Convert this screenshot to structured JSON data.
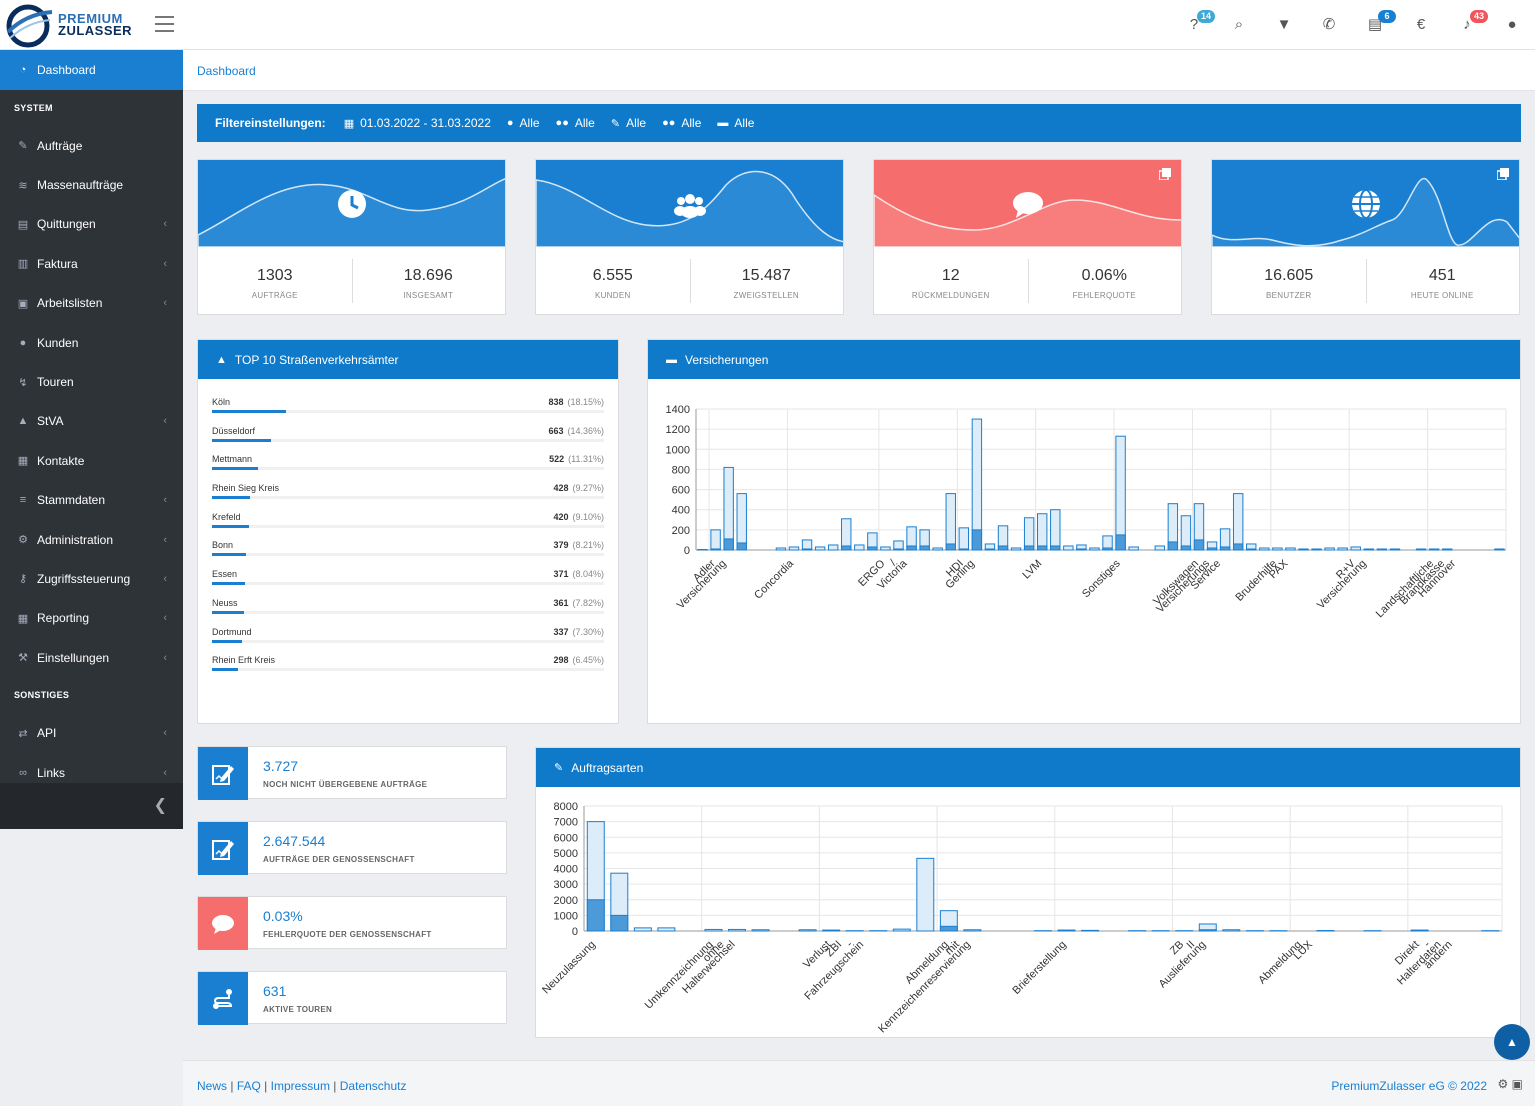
{
  "header": {
    "logo_line1": "PREMIUM",
    "logo_line2": "ZULASSER",
    "icons": [
      {
        "name": "help-icon",
        "glyph": "?",
        "badge": "14",
        "badge_color": "#3fa9d6"
      },
      {
        "name": "search-icon",
        "glyph": "⌕",
        "badge": "",
        "badge_color": ""
      },
      {
        "name": "filter-icon",
        "glyph": "▼",
        "badge": "",
        "badge_color": ""
      },
      {
        "name": "phone-icon",
        "glyph": "✆",
        "badge": "",
        "badge_color": ""
      },
      {
        "name": "documents-icon",
        "glyph": "▤",
        "badge": "6",
        "badge_color": "#1a7fd0"
      },
      {
        "name": "euro-icon",
        "glyph": "€",
        "badge": "",
        "badge_color": ""
      },
      {
        "name": "bell-icon",
        "glyph": "♪",
        "badge": "43",
        "badge_color": "#f2545b"
      },
      {
        "name": "user-icon",
        "glyph": "●",
        "badge": "",
        "badge_color": ""
      }
    ]
  },
  "sidebar": {
    "active": {
      "label": "Dashboard",
      "icon": "dashboard-icon"
    },
    "section_system": "SYSTEM",
    "section_other": "SONSTIGES",
    "items": [
      {
        "label": "Aufträge",
        "icon": "edit-icon",
        "chevron": false
      },
      {
        "label": "Massenaufträge",
        "icon": "layers-icon",
        "chevron": false
      },
      {
        "label": "Quittungen",
        "icon": "receipt-icon",
        "chevron": true
      },
      {
        "label": "Faktura",
        "icon": "invoice-icon",
        "chevron": true
      },
      {
        "label": "Arbeitslisten",
        "icon": "clipboard-icon",
        "chevron": true
      },
      {
        "label": "Kunden",
        "icon": "users-icon",
        "chevron": false
      },
      {
        "label": "Touren",
        "icon": "route-icon",
        "chevron": false
      },
      {
        "label": "StVA",
        "icon": "road-icon",
        "chevron": true
      },
      {
        "label": "Kontakte",
        "icon": "contacts-icon",
        "chevron": false
      },
      {
        "label": "Stammdaten",
        "icon": "list-icon",
        "chevron": true
      },
      {
        "label": "Administration",
        "icon": "cogs-icon",
        "chevron": true
      },
      {
        "label": "Zugriffssteuerung",
        "icon": "key-icon",
        "chevron": true
      },
      {
        "label": "Reporting",
        "icon": "table-icon",
        "chevron": true
      },
      {
        "label": "Einstellungen",
        "icon": "wrench-icon",
        "chevron": true
      }
    ],
    "other_items": [
      {
        "label": "API",
        "icon": "exchange-icon",
        "chevron": true
      },
      {
        "label": "Links",
        "icon": "link-icon",
        "chevron": true
      }
    ]
  },
  "breadcrumb": "Dashboard",
  "filter": {
    "title": "Filtereinstellungen:",
    "items": [
      {
        "icon": "calendar-icon",
        "glyph": "▦",
        "label": "01.03.2022 - 31.03.2022"
      },
      {
        "icon": "user-icon",
        "glyph": "●",
        "label": "Alle"
      },
      {
        "icon": "users-icon",
        "glyph": "●●",
        "label": "Alle"
      },
      {
        "icon": "edit-icon",
        "glyph": "✎",
        "label": "Alle"
      },
      {
        "icon": "group-icon",
        "glyph": "●●",
        "label": "Alle"
      },
      {
        "icon": "car-icon",
        "glyph": "▬",
        "label": "Alle"
      }
    ]
  },
  "cards": [
    {
      "color": "#1a7fd0",
      "icon": "clock-icon",
      "copy": false,
      "stats": [
        {
          "value": "1303",
          "label": "AUFTRÄGE"
        },
        {
          "value": "18.696",
          "label": "INSGESAMT"
        }
      ]
    },
    {
      "color": "#1a7fd0",
      "icon": "users-icon",
      "copy": false,
      "stats": [
        {
          "value": "6.555",
          "label": "KUNDEN"
        },
        {
          "value": "15.487",
          "label": "ZWEIGSTELLEN"
        }
      ]
    },
    {
      "color": "#f66d6d",
      "icon": "comment-icon",
      "copy": true,
      "stats": [
        {
          "value": "12",
          "label": "RÜCKMELDUNGEN"
        },
        {
          "value": "0.06%",
          "label": "FEHLERQUOTE"
        }
      ]
    },
    {
      "color": "#1a7fd0",
      "icon": "globe-icon",
      "copy": true,
      "stats": [
        {
          "value": "16.605",
          "label": "BENUTZER"
        },
        {
          "value": "451",
          "label": "HEUTE ONLINE"
        }
      ]
    }
  ],
  "top10": {
    "title": "TOP 10 Straßenverkehrsämter",
    "rows": [
      {
        "name": "Köln",
        "value": "838",
        "pct": "(18.15%)",
        "fraction": 0.1815
      },
      {
        "name": "Düsseldorf",
        "value": "663",
        "pct": "(14.36%)",
        "fraction": 0.1436
      },
      {
        "name": "Mettmann",
        "value": "522",
        "pct": "(11.31%)",
        "fraction": 0.1131
      },
      {
        "name": "Rhein Sieg Kreis",
        "value": "428",
        "pct": "(9.27%)",
        "fraction": 0.0927
      },
      {
        "name": "Krefeld",
        "value": "420",
        "pct": "(9.10%)",
        "fraction": 0.091
      },
      {
        "name": "Bonn",
        "value": "379",
        "pct": "(8.21%)",
        "fraction": 0.0821
      },
      {
        "name": "Essen",
        "value": "371",
        "pct": "(8.04%)",
        "fraction": 0.0804
      },
      {
        "name": "Neuss",
        "value": "361",
        "pct": "(7.82%)",
        "fraction": 0.0782
      },
      {
        "name": "Dortmund",
        "value": "337",
        "pct": "(7.30%)",
        "fraction": 0.073
      },
      {
        "name": "Rhein Erft Kreis",
        "value": "298",
        "pct": "(6.45%)",
        "fraction": 0.0645
      }
    ]
  },
  "versicherungen_title": "Versicherungen",
  "auftragsarten_title": "Auftragsarten",
  "info_cards": [
    {
      "value": "3.727",
      "label": "NOCH NICHT ÜBERGEBENE AUFTRÄGE",
      "icon": "edit-icon",
      "color": "#1a7fd0"
    },
    {
      "value": "2.647.544",
      "label": "AUFTRÄGE DER GENOSSENSCHAFT",
      "icon": "edit-icon",
      "color": "#1a7fd0"
    },
    {
      "value": "0.03%",
      "label": "FEHLERQUOTE DER GENOSSENSCHAFT",
      "icon": "comment-icon",
      "color": "#f66d6d"
    },
    {
      "value": "631",
      "label": "AKTIVE TOUREN",
      "icon": "route-icon",
      "color": "#1a7fd0"
    }
  ],
  "footer": {
    "links": [
      "News",
      "FAQ",
      "Impressum",
      "Datenschutz"
    ],
    "copyright": "PremiumZulasser eG © 2022"
  },
  "chart_data": [
    {
      "type": "bar",
      "title": "",
      "ylim": [
        0,
        1400
      ],
      "yticks": [
        0,
        200,
        400,
        600,
        800,
        1000,
        1200,
        1400
      ],
      "x_tick_labels": [
        {
          "index": 1,
          "lines": [
            "Adler",
            "Versicherung"
          ]
        },
        {
          "index": 7,
          "lines": [
            "Concordia"
          ]
        },
        {
          "index": 14,
          "lines": [
            "ERGO",
            "/",
            "Victoria"
          ]
        },
        {
          "index": 20,
          "lines": [
            "HDI",
            "Gerling"
          ]
        },
        {
          "index": 26,
          "lines": [
            "LVM"
          ]
        },
        {
          "index": 32,
          "lines": [
            "Sonstiges"
          ]
        },
        {
          "index": 38,
          "lines": [
            "Volkswagen",
            "Versicherungs",
            "Service"
          ]
        },
        {
          "index": 44,
          "lines": [
            "Bruderhilfe",
            "PAX"
          ]
        },
        {
          "index": 50,
          "lines": [
            "R+V",
            "Versicherung"
          ]
        },
        {
          "index": 56,
          "lines": [
            "Landschaftliche",
            "Brandkasse",
            "Hannover"
          ]
        }
      ],
      "grid": true,
      "series": [
        {
          "values": [
            5,
            200,
            820,
            560,
            0,
            0,
            20,
            30,
            100,
            30,
            50,
            310,
            50,
            170,
            30,
            90,
            230,
            200,
            20,
            560,
            220,
            1300,
            60,
            240,
            20,
            320,
            360,
            400,
            40,
            50,
            20,
            140,
            1130,
            30,
            0,
            40,
            460,
            340,
            460,
            80,
            210,
            560,
            60,
            20,
            20,
            20,
            10,
            10,
            20,
            20,
            30,
            10,
            10,
            10,
            0,
            10,
            10,
            10,
            0,
            0,
            0,
            10
          ]
        },
        {
          "values": [
            0,
            10,
            110,
            70,
            0,
            0,
            0,
            0,
            10,
            0,
            0,
            40,
            0,
            30,
            0,
            10,
            40,
            40,
            0,
            60,
            10,
            200,
            10,
            40,
            0,
            40,
            40,
            40,
            0,
            10,
            0,
            20,
            150,
            0,
            0,
            0,
            80,
            40,
            100,
            20,
            30,
            60,
            10,
            0,
            0,
            0,
            0,
            0,
            0,
            0,
            0,
            0,
            0,
            0,
            0,
            0,
            0,
            0,
            0,
            0,
            0,
            0
          ]
        }
      ]
    },
    {
      "type": "bar",
      "title": "",
      "ylim": [
        0,
        8000
      ],
      "yticks": [
        0,
        1000,
        2000,
        3000,
        4000,
        5000,
        6000,
        7000,
        8000
      ],
      "x_tick_labels": [
        {
          "index": 0,
          "lines": [
            "Neuzulassung"
          ]
        },
        {
          "index": 5,
          "lines": [
            "Umkennzeichnung",
            "ohne",
            "Halterwechsel"
          ]
        },
        {
          "index": 10,
          "lines": [
            "Verlust",
            "ZBI",
            "-",
            "Fahrzeugschein"
          ]
        },
        {
          "index": 15,
          "lines": [
            "Abmeldung",
            "mit",
            "Kennzeichenreservierung"
          ]
        },
        {
          "index": 20,
          "lines": [
            "Brieferstellung"
          ]
        },
        {
          "index": 25,
          "lines": [
            "ZB",
            "II",
            "Auslieferung"
          ]
        },
        {
          "index": 30,
          "lines": [
            "Abmeldung",
            "LUX"
          ]
        },
        {
          "index": 35,
          "lines": [
            "Direkt",
            "-",
            "Halterdaten",
            "ändern"
          ]
        }
      ],
      "grid": true,
      "series": [
        {
          "values": [
            7000,
            3700,
            200,
            200,
            0,
            100,
            100,
            80,
            0,
            80,
            60,
            20,
            20,
            120,
            4650,
            1300,
            80,
            0,
            0,
            20,
            60,
            40,
            0,
            20,
            20,
            20,
            450,
            80,
            20,
            20,
            0,
            30,
            0,
            20,
            0,
            60,
            0,
            0,
            20
          ]
        },
        {
          "values": [
            2000,
            1000,
            0,
            0,
            0,
            0,
            0,
            0,
            0,
            0,
            0,
            0,
            0,
            0,
            0,
            300,
            0,
            0,
            0,
            0,
            0,
            0,
            0,
            0,
            0,
            0,
            80,
            0,
            0,
            0,
            0,
            0,
            0,
            0,
            0,
            0,
            0,
            0,
            0
          ]
        }
      ]
    }
  ]
}
